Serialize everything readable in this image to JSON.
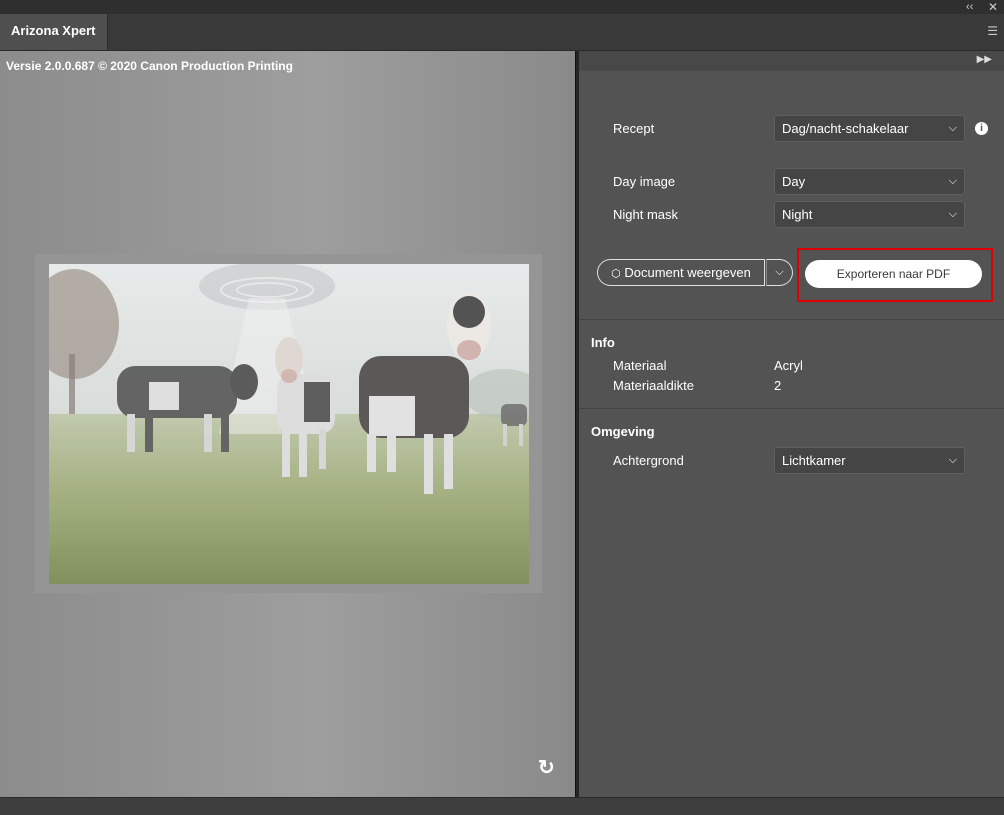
{
  "window": {
    "collapse_icon": "double-chevron-left-icon",
    "close_icon": "close-icon"
  },
  "tab": {
    "label": "Arizona Xpert"
  },
  "panel_menu_icon": "hamburger-menu-icon",
  "preview": {
    "version_text": "Versie 2.0.0.687 © 2020 Canon Production Printing",
    "refresh_icon": "refresh-icon"
  },
  "settings": {
    "expand_icon": "double-chevron-right-icon",
    "recipe": {
      "label": "Recept",
      "value": "Dag/nacht-schakelaar"
    },
    "day_image": {
      "label": "Day image",
      "value": "Day"
    },
    "night_mask": {
      "label": "Night mask",
      "value": "Night"
    },
    "document_button": "Document weergeven",
    "export_button": "Exporteren naar PDF",
    "highlight_color": "#e00000"
  },
  "info": {
    "heading": "Info",
    "material_label": "Materiaal",
    "material_value": "Acryl",
    "thickness_label": "Materiaaldikte",
    "thickness_value": "2"
  },
  "environment": {
    "heading": "Omgeving",
    "background_label": "Achtergrond",
    "background_value": "Lichtkamer"
  }
}
